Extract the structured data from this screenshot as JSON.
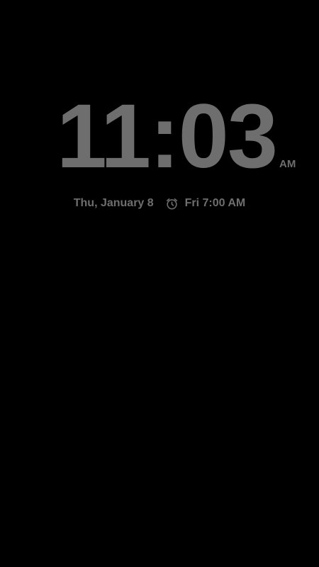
{
  "clock": {
    "time": "11:03",
    "ampm": "AM"
  },
  "info": {
    "date": "Thu, January 8",
    "next_alarm": "Fri 7:00 AM"
  },
  "colors": {
    "background": "#000000",
    "text": "#6e6e6e"
  },
  "icons": {
    "alarm": "alarm-clock-icon"
  }
}
